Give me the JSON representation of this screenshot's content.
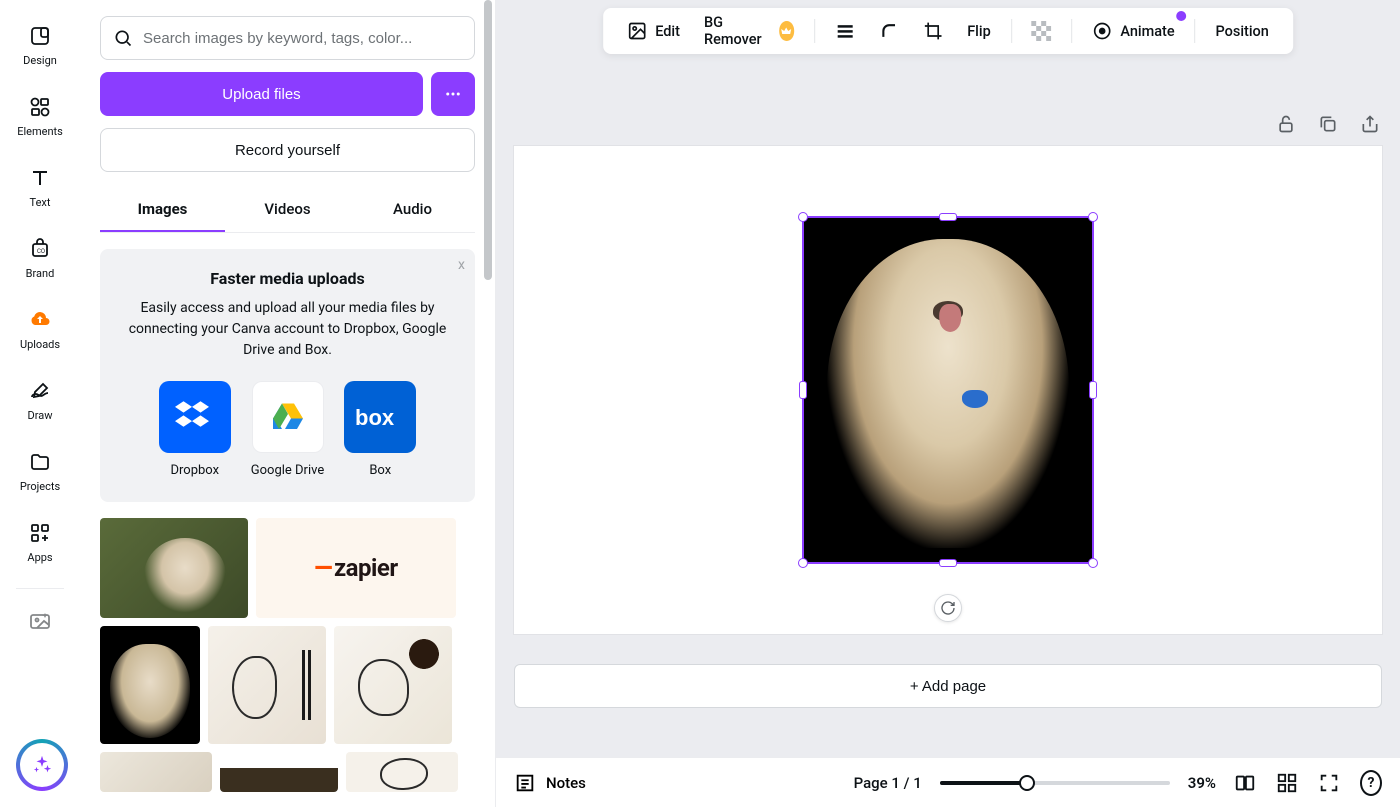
{
  "rail": {
    "items": [
      {
        "label": "Design"
      },
      {
        "label": "Elements"
      },
      {
        "label": "Text"
      },
      {
        "label": "Brand"
      },
      {
        "label": "Uploads"
      },
      {
        "label": "Draw"
      },
      {
        "label": "Projects"
      },
      {
        "label": "Apps"
      }
    ]
  },
  "search": {
    "placeholder": "Search images by keyword, tags, color..."
  },
  "upload": {
    "button": "Upload files"
  },
  "record": {
    "button": "Record yourself"
  },
  "tabs": {
    "images": "Images",
    "videos": "Videos",
    "audio": "Audio"
  },
  "promo": {
    "title": "Faster media uploads",
    "desc": "Easily access and upload all your media files by connecting your Canva account to Dropbox, Google Drive and Box.",
    "apps": {
      "dropbox": "Dropbox",
      "gdrive": "Google Drive",
      "box": "Box"
    },
    "close": "x"
  },
  "toolbar": {
    "edit": "Edit",
    "bg_remover": "BG Remover",
    "flip": "Flip",
    "animate": "Animate",
    "position": "Position"
  },
  "add_page": "+ Add page",
  "footer": {
    "notes": "Notes",
    "page": "Page 1 / 1",
    "zoom": "39%"
  },
  "zapier_text": "zapier",
  "help": "?"
}
